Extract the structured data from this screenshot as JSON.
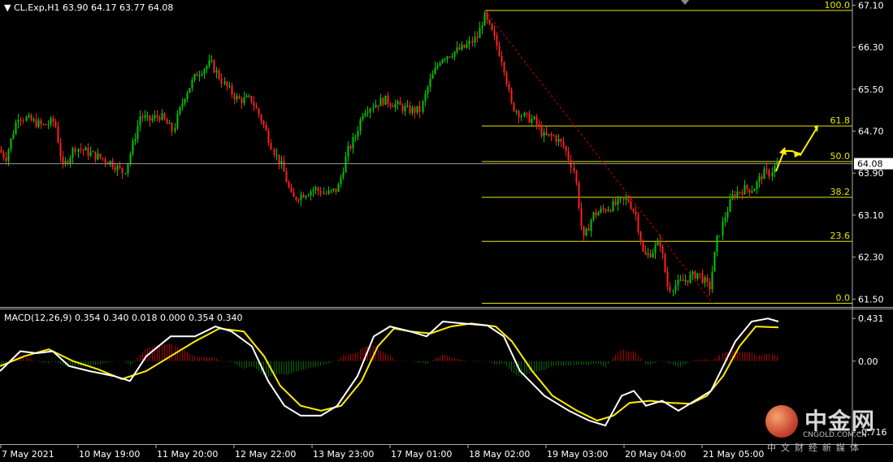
{
  "header": {
    "arrow": "▼",
    "symbol_info": "CL.Exp,H1  63.90 64.17 63.77 64.08"
  },
  "macd_header": "MACD(12,26,9) 0.354 0.340 0.018 0.000 0.354 0.340",
  "price_axis": [
    "67.10",
    "66.30",
    "65.50",
    "64.70",
    "63.90",
    "63.10",
    "62.30",
    "61.50"
  ],
  "current_price": "64.08",
  "macd_axis": [
    "0.431",
    "0.00",
    "-0.716"
  ],
  "fib_levels": [
    {
      "label": "100.0",
      "price": 67.0
    },
    {
      "label": "61.8",
      "price": 64.8
    },
    {
      "label": "50.0",
      "price": 64.12
    },
    {
      "label": "38.2",
      "price": 63.44
    },
    {
      "label": "23.6",
      "price": 62.6
    },
    {
      "label": "0.0",
      "price": 61.42
    }
  ],
  "time_axis": [
    "7 May 2021",
    "10 May 19:00",
    "11 May 20:00",
    "12 May 22:00",
    "13 May 23:00",
    "17 May 01:00",
    "18 May 02:00",
    "19 May 03:00",
    "20 May 04:00",
    "21 May 05:00"
  ],
  "watermark": {
    "brand": "中金网",
    "domain": "CNGOLD.COM.CN",
    "slogan": "中文财经新媒体"
  },
  "colors": {
    "bull": "#00c800",
    "bear": "#ff2020",
    "fib": "#e6e600",
    "macd_line": "#ffffff",
    "signal_line": "#ffee00",
    "hist_pos": "#aa0000",
    "hist_neg": "#006600",
    "background": "#000000",
    "axis_text": "#ffffff"
  }
}
